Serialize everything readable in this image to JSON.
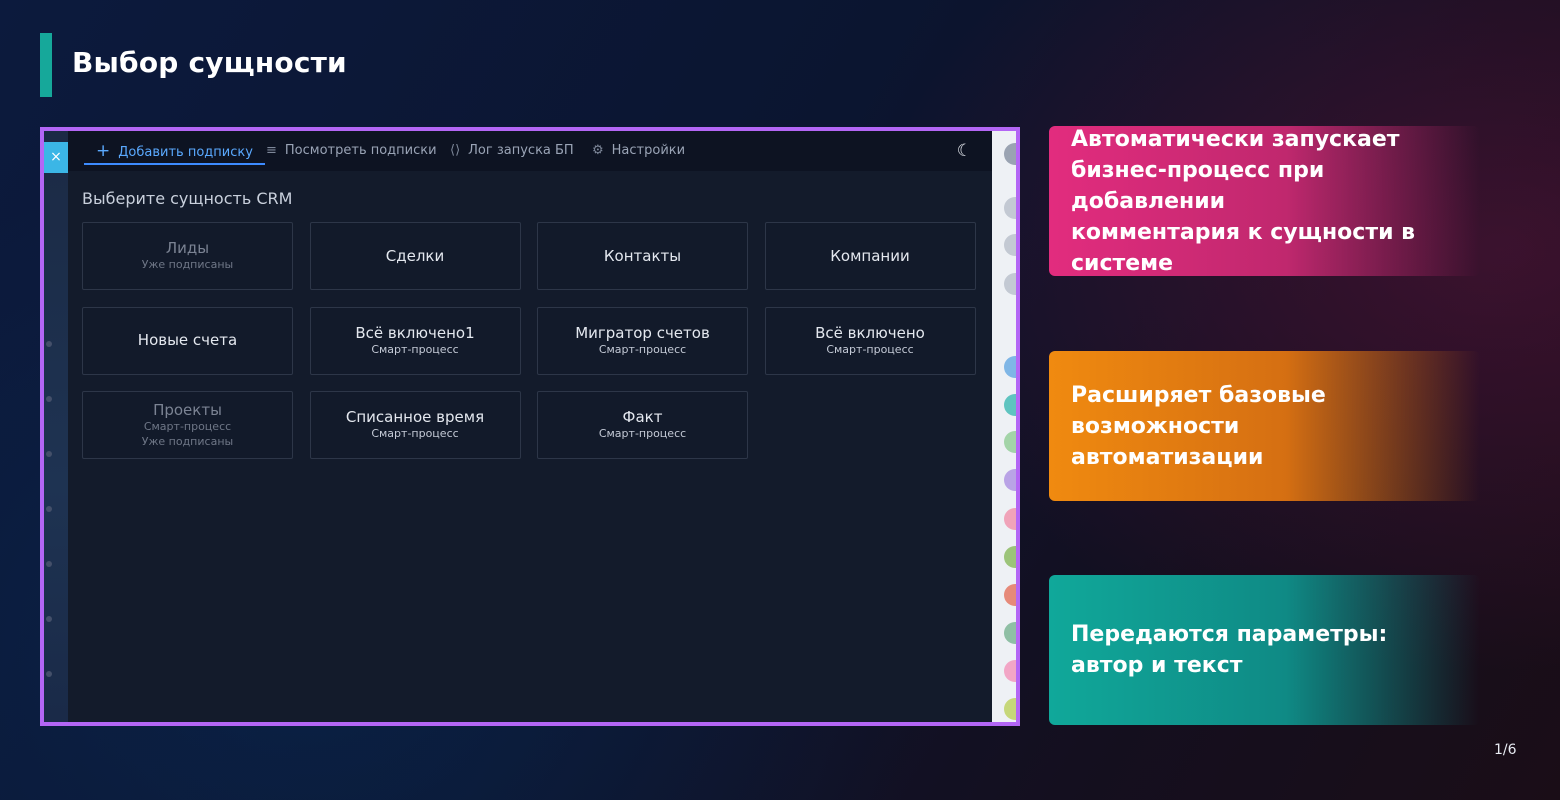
{
  "slide": {
    "title": "Выбор сущности",
    "page_indicator": "1/6"
  },
  "app": {
    "close_icon": "×",
    "tabs": [
      {
        "icon": "plus-icon",
        "glyph": "+",
        "label": "Добавить подписку",
        "active": true
      },
      {
        "icon": "list-icon",
        "glyph": "≡",
        "label": "Посмотреть подписки",
        "active": false
      },
      {
        "icon": "code-log-icon",
        "glyph": "⟨⟩",
        "label": "Лог запуска БП",
        "active": false
      },
      {
        "icon": "sliders-icon",
        "glyph": "⚙",
        "label": "Настройки",
        "active": false
      }
    ],
    "theme_icon": "moon-icon",
    "heading": "Выберите сущность CRM",
    "cards": [
      {
        "name": "Лиды",
        "subs": [
          "Уже подписаны"
        ],
        "disabled": true
      },
      {
        "name": "Сделки",
        "subs": [],
        "disabled": false
      },
      {
        "name": "Контакты",
        "subs": [],
        "disabled": false
      },
      {
        "name": "Компании",
        "subs": [],
        "disabled": false
      },
      {
        "name": "Новые счета",
        "subs": [],
        "disabled": false
      },
      {
        "name": "Всё включено1",
        "subs": [
          "Смарт-процесс"
        ],
        "disabled": false
      },
      {
        "name": "Мигратор счетов",
        "subs": [
          "Смарт-процесс"
        ],
        "disabled": false
      },
      {
        "name": "Всё включено",
        "subs": [
          "Смарт-процесс"
        ],
        "disabled": false
      },
      {
        "name": "Проекты",
        "subs": [
          "Смарт-процесс",
          "Уже подписаны"
        ],
        "disabled": true
      },
      {
        "name": "Списанное время",
        "subs": [
          "Смарт-процесс"
        ],
        "disabled": false
      },
      {
        "name": "Факт",
        "subs": [
          "Смарт-процесс"
        ],
        "disabled": false
      }
    ]
  },
  "panels": [
    {
      "lines": [
        "Автоматически запускает",
        "бизнес-процесс при добавлении",
        "комментария к сущности в системе"
      ],
      "color": "#e22c7e"
    },
    {
      "lines": [
        "Расширяет базовые возможности",
        "автоматизации"
      ],
      "color": "#f08a10"
    },
    {
      "lines": [
        "Передаются параметры:",
        "автор и текст"
      ],
      "color": "#10a89a"
    }
  ]
}
